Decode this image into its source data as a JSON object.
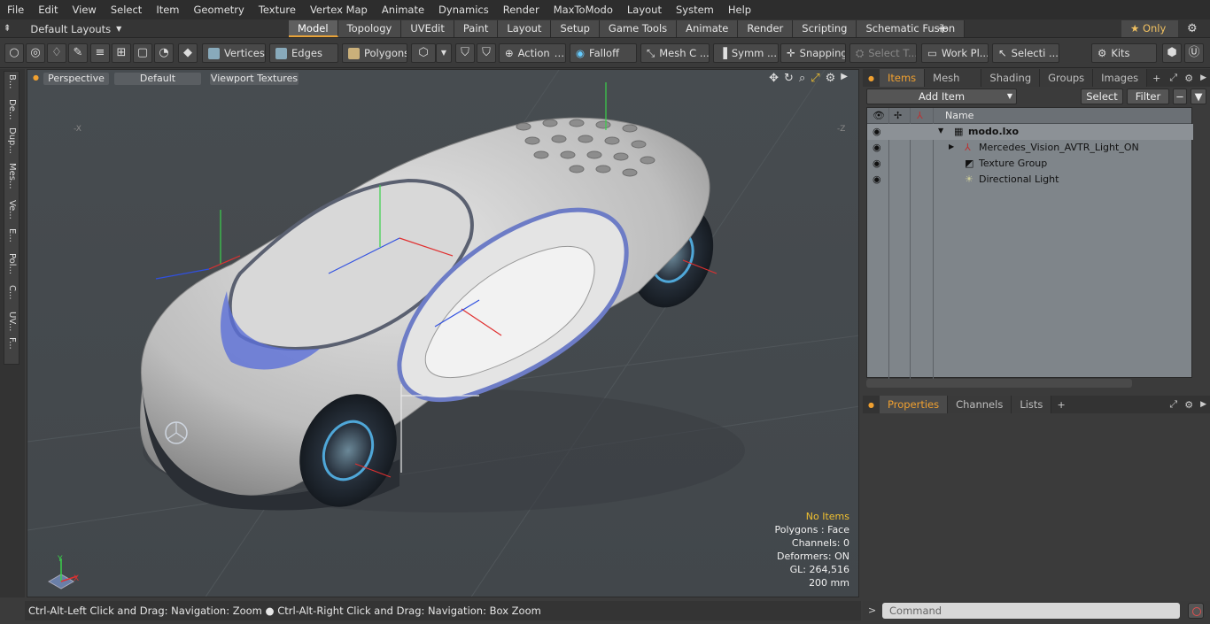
{
  "menu": [
    "File",
    "Edit",
    "View",
    "Select",
    "Item",
    "Geometry",
    "Texture",
    "Vertex Map",
    "Animate",
    "Dynamics",
    "Render",
    "MaxToModo",
    "Layout",
    "System",
    "Help"
  ],
  "layout_selector": "Default Layouts",
  "mode_tabs": [
    {
      "label": "Model",
      "active": true
    },
    {
      "label": "Topology"
    },
    {
      "label": "UVEdit"
    },
    {
      "label": "Paint"
    },
    {
      "label": "Layout"
    },
    {
      "label": "Setup"
    },
    {
      "label": "Game Tools"
    },
    {
      "label": "Animate"
    },
    {
      "label": "Render"
    },
    {
      "label": "Scripting"
    },
    {
      "label": "Schematic Fusion"
    }
  ],
  "only_label": "Only",
  "toolbar": {
    "vertices": "Vertices",
    "edges": "Edges",
    "polygons": "Polygons",
    "action": "Action",
    "falloff": "Falloff",
    "mesh": "Mesh C ...",
    "symm": "Symm ...",
    "snapping": "Snapping",
    "select_t": "Select T...",
    "work_pl": "Work Pl...",
    "selecti": "Selecti ...",
    "kits": "Kits"
  },
  "left_tabs": [
    "B...",
    "De...",
    "Dup...",
    "Mes...",
    "Ve...",
    "E...",
    "Pol...",
    "C...",
    "UV...",
    "F..."
  ],
  "viewport": {
    "view_mode": "Perspective",
    "shading": "Default",
    "textures": "Viewport Textures",
    "hud": {
      "status": "No Items",
      "polygons": "Polygons : Face",
      "channels": "Channels: 0",
      "deformers": "Deformers: ON",
      "gl": "GL: 264,516",
      "scale": "200 mm"
    },
    "axis_labels": {
      "x": "X",
      "y": "Y",
      "neg_x": "-X",
      "neg_z": "-Z"
    }
  },
  "status_text": "Ctrl-Alt-Left Click and Drag: Navigation: Zoom ● Ctrl-Alt-Right Click and Drag: Navigation: Box Zoom",
  "items_panel": {
    "tabs": [
      {
        "label": "Items",
        "active": true
      },
      {
        "label": "Mesh Ops"
      },
      {
        "label": "Shading"
      },
      {
        "label": "Groups"
      },
      {
        "label": "Images"
      }
    ],
    "add_item": "Add Item",
    "select": "Select",
    "filter": "Filter",
    "name_header": "Name",
    "rows": [
      {
        "label": "modo.lxo"
      },
      {
        "label": "Mercedes_Vision_AVTR_Light_ON"
      },
      {
        "label": "Texture Group"
      },
      {
        "label": "Directional Light"
      }
    ]
  },
  "props_panel": {
    "tabs": [
      {
        "label": "Properties",
        "active": true
      },
      {
        "label": "Channels"
      },
      {
        "label": "Lists"
      }
    ]
  },
  "command_placeholder": "Command"
}
